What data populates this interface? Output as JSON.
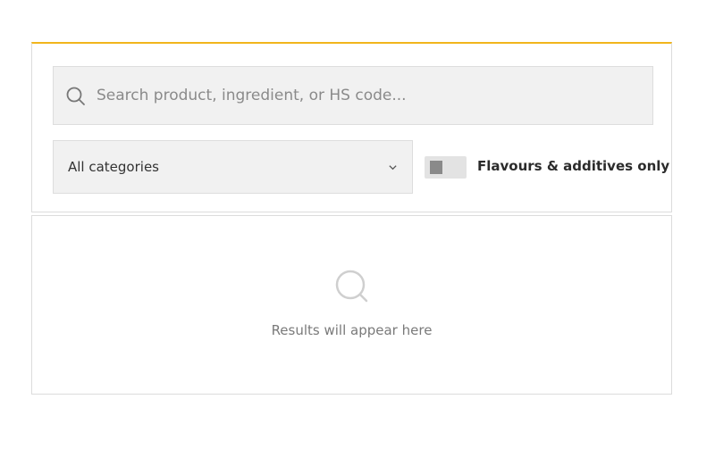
{
  "search": {
    "placeholder": "Search product, ingredient, or HS code...",
    "value": ""
  },
  "filters": {
    "category_selected": "All categories",
    "toggle_label": "Flavours & additives only",
    "toggle_on": false
  },
  "results": {
    "empty_message": "Results will appear here"
  },
  "colors": {
    "accent": "#f1b51c",
    "field_bg": "#f1f1f1",
    "muted_text": "#7a7a7a"
  },
  "icons": {
    "search": "search-icon",
    "dropdown": "chevron-down-icon",
    "empty_state": "search-icon"
  }
}
